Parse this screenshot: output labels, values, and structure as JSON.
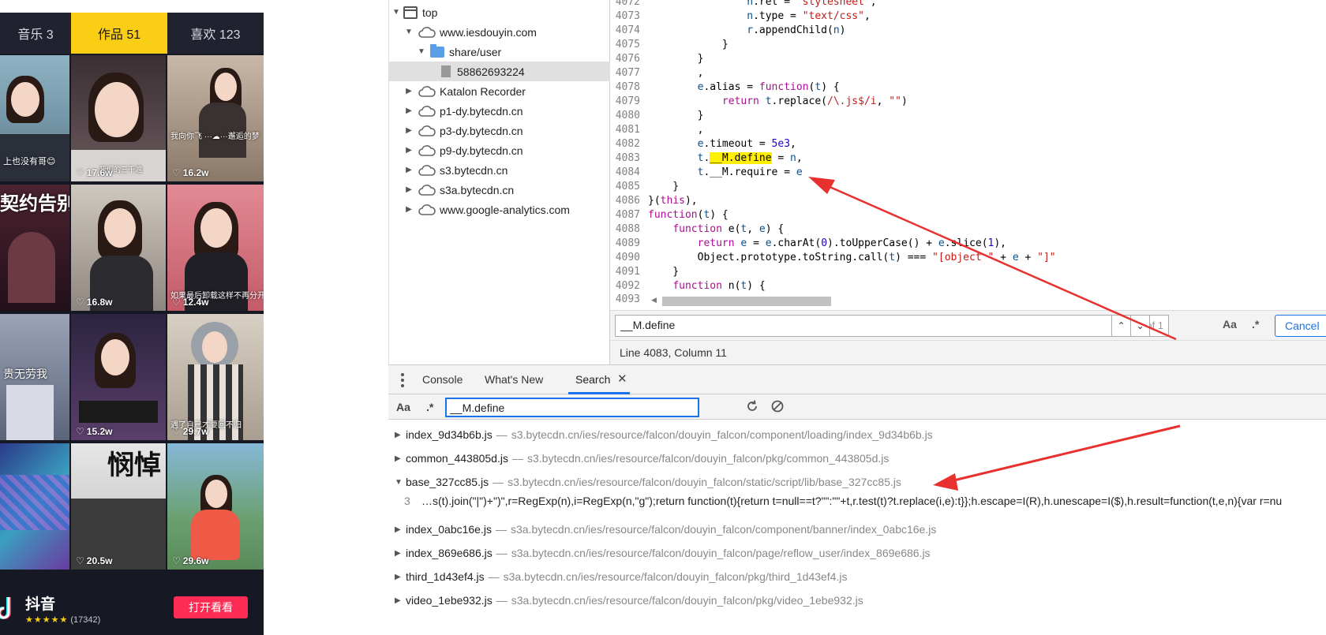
{
  "phone": {
    "tabs": [
      {
        "label": "音乐 3"
      },
      {
        "label": "作品 51"
      },
      {
        "label": "喜欢 123"
      }
    ],
    "grid": [
      {
        "likes": "",
        "caption": "上也没有哥😊"
      },
      {
        "likes": "17.6w",
        "caption": "我们的三千遍"
      },
      {
        "likes": "16.2w",
        "caption": "我向你飞 ···☁···邂逅的梦"
      },
      {
        "likes": "",
        "caption": "契约告别"
      },
      {
        "likes": "16.8w",
        "caption": ""
      },
      {
        "likes": "12.4w",
        "caption": "如果最后卸载这样不再分开"
      },
      {
        "likes": "",
        "caption": "贵无劳我"
      },
      {
        "likes": "15.2w",
        "caption": ""
      },
      {
        "likes": "29.7w",
        "caption": "遇了自己才要回不归"
      },
      {
        "likes": "",
        "caption": ""
      },
      {
        "likes": "20.5w",
        "caption": "悯悼"
      },
      {
        "likes": "29.6w",
        "caption": ""
      }
    ],
    "footer": {
      "app_name": "抖音",
      "stars": "★★★★★",
      "rating_count": "(17342)",
      "open_button": "打开看看"
    }
  },
  "tree": {
    "items": [
      {
        "label": "top"
      },
      {
        "label": "www.iesdouyin.com"
      },
      {
        "label": "share/user"
      },
      {
        "label": "58862693224"
      },
      {
        "label": "Katalon Recorder"
      },
      {
        "label": "p1-dy.bytecdn.cn"
      },
      {
        "label": "p3-dy.bytecdn.cn"
      },
      {
        "label": "p9-dy.bytecdn.cn"
      },
      {
        "label": "s3.bytecdn.cn"
      },
      {
        "label": "s3a.bytecdn.cn"
      },
      {
        "label": "www.google-analytics.com"
      }
    ]
  },
  "code": {
    "lines": [
      {
        "num": "4072",
        "text": "                n.rel = \"stylesheet\","
      },
      {
        "num": "4073",
        "text": "                n.type = \"text/css\","
      },
      {
        "num": "4074",
        "text": "                r.appendChild(n)"
      },
      {
        "num": "4075",
        "text": "            }"
      },
      {
        "num": "4076",
        "text": "        }"
      },
      {
        "num": "4077",
        "text": "        ,"
      },
      {
        "num": "4078",
        "text": "        e.alias = function(t) {"
      },
      {
        "num": "4079",
        "text": "            return t.replace(/\\.js$/i, \"\")"
      },
      {
        "num": "4080",
        "text": "        }"
      },
      {
        "num": "4081",
        "text": "        ,"
      },
      {
        "num": "4082",
        "text": "        e.timeout = 5e3,"
      },
      {
        "num": "4083",
        "text": "        t.__M.define = n,"
      },
      {
        "num": "4084",
        "text": "        t.__M.require = e"
      },
      {
        "num": "4085",
        "text": "    }"
      },
      {
        "num": "4086",
        "text": "}(this),"
      },
      {
        "num": "4087",
        "text": "function(t) {"
      },
      {
        "num": "4088",
        "text": "    function e(t, e) {"
      },
      {
        "num": "4089",
        "text": "        return e = e.charAt(0).toUpperCase() + e.slice(1),"
      },
      {
        "num": "4090",
        "text": "        Object.prototype.toString.call(t) === \"[object \" + e + \"]\""
      },
      {
        "num": "4091",
        "text": "    }"
      },
      {
        "num": "4092",
        "text": "    function n(t) {"
      },
      {
        "num": "4093",
        "text": ""
      }
    ]
  },
  "find_bar": {
    "query": "__M.define",
    "count": "1 of 1",
    "match_case": "Aa",
    "regex": ".*",
    "cancel": "Cancel"
  },
  "status": {
    "position": "Line 4083, Column 11"
  },
  "drawer": {
    "tabs": [
      {
        "label": "Console"
      },
      {
        "label": "What's New"
      },
      {
        "label": "Search"
      }
    ],
    "close": "✕"
  },
  "search": {
    "match_case": "Aa",
    "regex": ".*",
    "query": "__M.define",
    "results": [
      {
        "name": "index_9d34b6b.js",
        "path": "s3.bytecdn.cn/ies/resource/falcon/douyin_falcon/component/loading/index_9d34b6b.js",
        "expanded": false
      },
      {
        "name": "common_443805d.js",
        "path": "s3.bytecdn.cn/ies/resource/falcon/douyin_falcon/pkg/common_443805d.js",
        "expanded": false
      },
      {
        "name": "base_327cc85.js",
        "path": "s3.bytecdn.cn/ies/resource/falcon/douyin_falcon/static/script/lib/base_327cc85.js",
        "expanded": true
      },
      {
        "name": "index_0abc16e.js",
        "path": "s3a.bytecdn.cn/ies/resource/falcon/douyin_falcon/component/banner/index_0abc16e.js",
        "expanded": false
      },
      {
        "name": "index_869e686.js",
        "path": "s3a.bytecdn.cn/ies/resource/falcon/douyin_falcon/page/reflow_user/index_869e686.js",
        "expanded": false
      },
      {
        "name": "third_1d43ef4.js",
        "path": "s3a.bytecdn.cn/ies/resource/falcon/douyin_falcon/pkg/third_1d43ef4.js",
        "expanded": false
      },
      {
        "name": "video_1ebe932.js",
        "path": "s3a.bytecdn.cn/ies/resource/falcon/douyin_falcon/pkg/video_1ebe932.js",
        "expanded": false
      }
    ],
    "match": {
      "line": "3",
      "text": "…s(t).join(\"|\")+\")\",r=RegExp(n),i=RegExp(n,\"g\");return function(t){return t=null==t?\"\":\"\"+t,r.test(t)?t.replace(i,e):t}};h.escape=I(R),h.unescape=I($),h.result=function(t,e,n){var r=nu"
    }
  },
  "colors": {
    "accent": "#1a73e8",
    "highlight": "#ffef00",
    "annotation_arrow": "#e8312f",
    "douyin_yellow": "#face15",
    "douyin_red": "#fe2c55"
  }
}
